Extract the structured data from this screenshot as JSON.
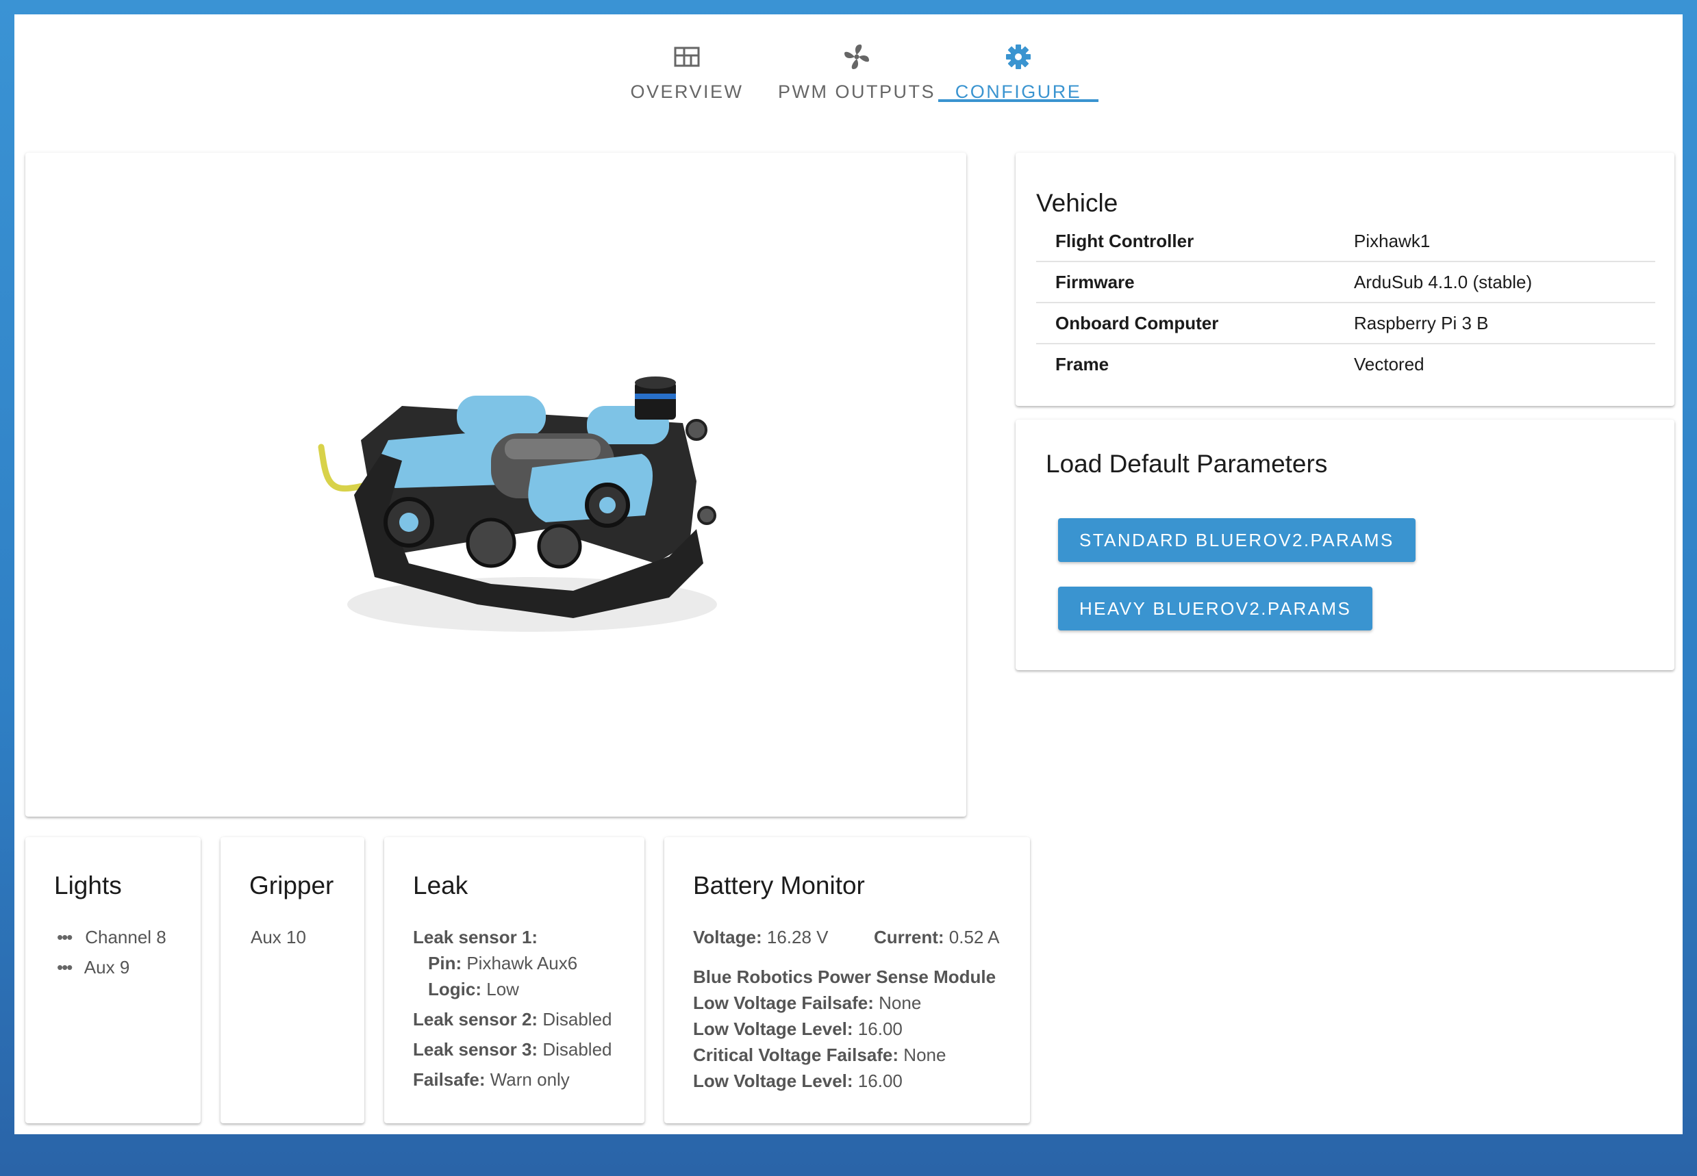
{
  "tabs": [
    {
      "label": "OVERVIEW",
      "icon": "grid-icon"
    },
    {
      "label": "PWM OUTPUTS",
      "icon": "fan-icon"
    },
    {
      "label": "CONFIGURE",
      "icon": "gear-icon",
      "active": true
    }
  ],
  "vehicle": {
    "title": "Vehicle",
    "rows": [
      {
        "key": "Flight Controller",
        "value": "Pixhawk1"
      },
      {
        "key": "Firmware",
        "value": "ArduSub 4.1.0 (stable)"
      },
      {
        "key": "Onboard Computer",
        "value": "Raspberry Pi 3 B"
      },
      {
        "key": "Frame",
        "value": "Vectored"
      }
    ]
  },
  "params": {
    "title": "Load Default Parameters",
    "buttons": [
      "STANDARD BLUEROV2.PARAMS",
      "HEAVY BLUEROV2.PARAMS"
    ]
  },
  "lights": {
    "title": "Lights",
    "items": [
      "Channel 8",
      "Aux 9"
    ]
  },
  "gripper": {
    "title": "Gripper",
    "value": "Aux 10"
  },
  "leak": {
    "title": "Leak",
    "sensor1_label": "Leak sensor 1:",
    "pin_label": "Pin:",
    "pin_value": "Pixhawk Aux6",
    "logic_label": "Logic:",
    "logic_value": "Low",
    "sensor2_label": "Leak sensor 2:",
    "sensor2_value": "Disabled",
    "sensor3_label": "Leak sensor 3:",
    "sensor3_value": "Disabled",
    "failsafe_label": "Failsafe:",
    "failsafe_value": "Warn only"
  },
  "battery": {
    "title": "Battery Monitor",
    "voltage_label": "Voltage:",
    "voltage_value": "16.28 V",
    "current_label": "Current:",
    "current_value": "0.52 A",
    "module": "Blue Robotics Power Sense Module",
    "low_failsafe_label": "Low Voltage Failsafe:",
    "low_failsafe_value": "None",
    "low_level_label": "Low Voltage Level:",
    "low_level_value": "16.00",
    "crit_failsafe_label": "Critical Voltage Failsafe:",
    "crit_failsafe_value": "None",
    "crit_level_label": "Low Voltage Level:",
    "crit_level_value": "16.00"
  },
  "colors": {
    "accent": "#3a94d0",
    "rov_blue": "#7ec3e6",
    "rov_frame": "#2a2a2a",
    "tether": "#d8d24a"
  }
}
